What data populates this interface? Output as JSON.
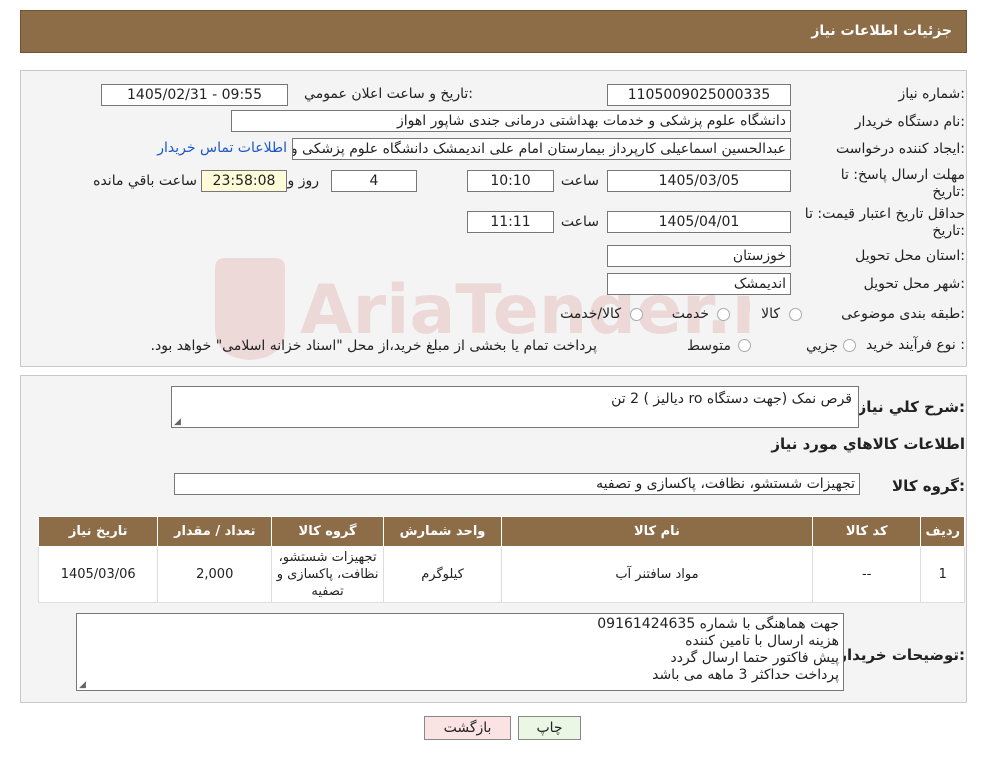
{
  "header": {
    "title": "جزئیات اطلاعات نیاز"
  },
  "info": {
    "need_number_label": "شماره نیاز:",
    "need_number": "1105009025000335",
    "announce_label": "تاریخ و ساعت اعلان عمومي:",
    "announce_value": "1405/02/31 - 09:55",
    "buyer_org_label": "نام دستگاه خريدار:",
    "buyer_org": "دانشگاه علوم پزشکی و خدمات بهداشتی درمانی جندی شاپور اهواز",
    "creator_label": "ايجاد کننده درخواست:",
    "creator": "عبدالحسین اسماعیلی کارپرداز بیمارستان امام علی اندیمشک دانشگاه علوم پزشکی و خدمات بهداشتی درمانی جندی شاپور اهواز",
    "contact_link": "اطلاعات تماس خريدار",
    "deadline_label": "مهلت ارسال پاسخ: تا",
    "deadline_label2": "تاریخ:",
    "deadline_date": "1405/03/05",
    "time_label": "ساعت",
    "deadline_time": "10:10",
    "days_value": "4",
    "days_label": "روز و",
    "remaining_value": "23:58:08",
    "remaining_label": "ساعت باقي مانده",
    "validity_label": "حداقل تاريخ اعتبار قيمت: تا",
    "validity_label2": "تاريخ:",
    "validity_date": "1405/04/01",
    "validity_time": "11:11",
    "province_label": "استان محل تحويل:",
    "province": "خوزستان",
    "city_label": "شهر محل تحويل:",
    "city": "انديمشک",
    "category_label": "طبقه بندی موضوعی:",
    "category_options": [
      "کالا",
      "خدمت",
      "کالا/خدمت"
    ],
    "process_label": "نوع فرآيند خريد :",
    "process_options": [
      "جزيي",
      "متوسط"
    ],
    "process_note": "پرداخت تمام يا بخشی از مبلغ خريد،از محل \"اسناد خزانه اسلامی\" خواهد بود."
  },
  "watermark": {
    "text": "AriaTender.neT"
  },
  "details": {
    "summary_label": "شرح کلي نياز:",
    "summary": "قرص نمک (جهت دستگاه ro دیالیز ) 2 تن",
    "goods_info_title": "اطلاعات کالاهاي مورد نياز",
    "goods_group_label": "گروه کالا:",
    "goods_group": "تجهیزات شستشو، نظافت، پاکسازی و تصفیه",
    "table": {
      "headers": [
        "رديف",
        "کد کالا",
        "نام کالا",
        "واحد شمارش",
        "گروه کالا",
        "تعداد / مقدار",
        "تاریخ نیاز"
      ],
      "rows": [
        [
          "1",
          "--",
          "مواد سافتنر آب",
          "کیلوگرم",
          "تجهیزات شستشو، نظافت، پاکسازی و تصفیه",
          "2,000",
          "1405/03/06"
        ]
      ]
    },
    "buyer_notes_label": "توضيحات خريدار:",
    "buyer_notes": [
      "جهت هماهنگی با شماره 09161424635",
      "هزینه ارسال با تامین کننده",
      "پیش فاکتور حتما ارسال گردد",
      "پرداخت حداکثر 3 ماهه می باشد"
    ]
  },
  "buttons": {
    "print": "چاپ",
    "back": "بازگشت"
  },
  "colors": {
    "header_bg": "#8c6d47",
    "panel_bg": "#f4f4f4",
    "back_btn_bg": "#fbe3e3",
    "print_btn_bg": "#eaf7e5"
  }
}
